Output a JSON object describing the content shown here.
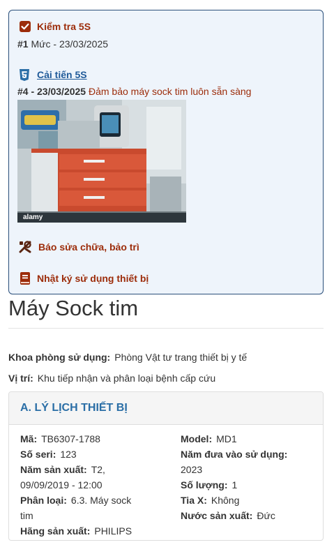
{
  "actions": {
    "kiem_tra": {
      "label": "Kiểm tra 5S",
      "meta_prefix": "#1",
      "meta_text": "Mức - 23/03/2025"
    },
    "cai_tien": {
      "label": "Cải tiến 5S",
      "meta_prefix": "#4 - 23/03/2025",
      "meta_text": "Đảm bảo máy sock tim luôn sẵn sàng",
      "image_watermark": "alamy"
    },
    "bao_sua": {
      "label": "Báo sửa chữa, bảo trì"
    },
    "nhat_ky": {
      "label": "Nhật ký sử dụng thiết bị"
    }
  },
  "device": {
    "title": "Máy Sock tim",
    "khoa_phong": {
      "label": "Khoa phòng sử dụng:",
      "value": "Phòng Vật tư trang thiết bị y tế"
    },
    "vi_tri": {
      "label": "Vị trí:",
      "value": "Khu tiếp nhận và phân loại bệnh cấp cứu"
    }
  },
  "profile": {
    "heading": "A. LÝ LỊCH THIẾT BỊ",
    "left": {
      "ma": {
        "label": "Mã:",
        "value": "TB6307-1788"
      },
      "so_seri": {
        "label": "Số seri:",
        "value": "123"
      },
      "nam_sx": {
        "label": "Năm sản xuất:",
        "value_l1": "T2,",
        "value_l2": "09/09/2019 - 12:00"
      },
      "phan_loai": {
        "label": "Phân loại:",
        "value_l1": "6.3. Máy sock",
        "value_l2": "tim"
      },
      "hang_sx": {
        "label": "Hãng sản xuất:",
        "value": "PHILIPS"
      }
    },
    "right": {
      "model": {
        "label": "Model:",
        "value": "MD1"
      },
      "nam_dua": {
        "label": "Năm đưa vào sử dụng:",
        "value": "2023"
      },
      "so_luong": {
        "label": "Số lượng:",
        "value": "1"
      },
      "tia_x": {
        "label": "Tia X:",
        "value": "Không"
      },
      "nuoc_sx": {
        "label": "Nước sản xuất:",
        "value": "Đức"
      }
    }
  },
  "colors": {
    "accent_red": "#9c2c0a",
    "accent_blue": "#1f5a99",
    "panel_head": "#2a6ea6"
  }
}
